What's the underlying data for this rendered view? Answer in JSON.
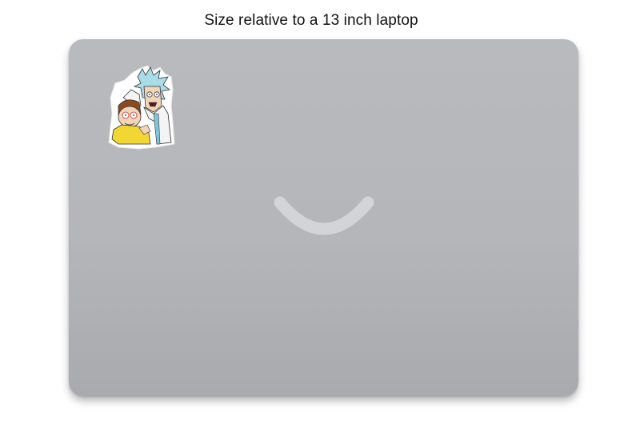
{
  "caption": "Size relative to a 13 inch laptop",
  "colors": {
    "lid": "#b7b8bc",
    "logo": "#d2d4d7",
    "background": "#ffffff",
    "sticker_yellow": "#f2d634",
    "sticker_blue": "#a9dbe8",
    "sticker_skin": "#f1d5b8",
    "sticker_brown": "#8a4a1e"
  },
  "icons": {
    "logo": "smile-logo-icon",
    "sticker": "rick-and-morty-sticker-icon"
  }
}
